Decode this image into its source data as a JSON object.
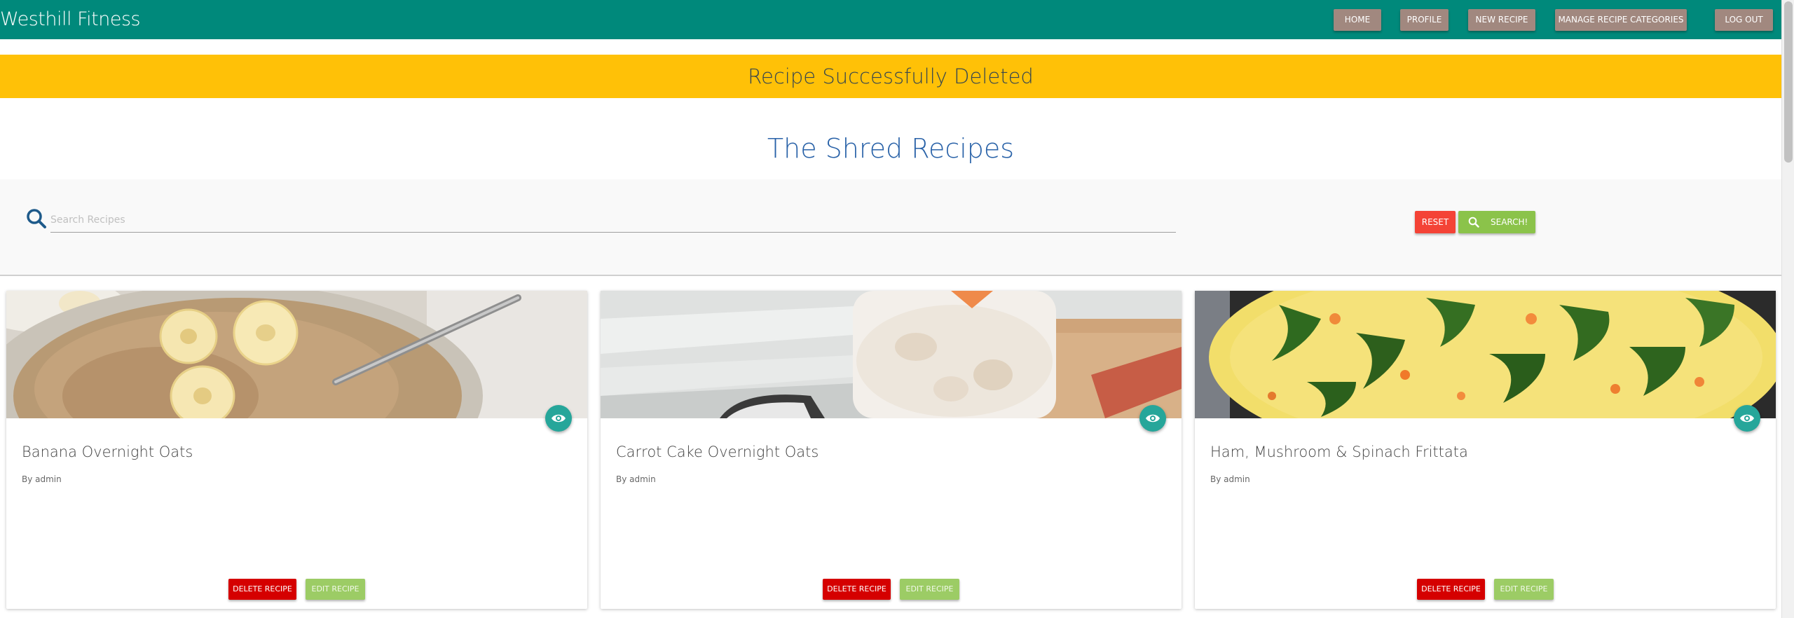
{
  "navbar": {
    "brand": "Westhill Fitness",
    "items": [
      {
        "label": "HOME"
      },
      {
        "label": "PROFILE"
      },
      {
        "label": "NEW RECIPE"
      },
      {
        "label": "MANAGE RECIPE CATEGORIES"
      },
      {
        "label": "LOG OUT"
      }
    ]
  },
  "alert": {
    "message": "Recipe Successfully Deleted",
    "color": "#ffc107"
  },
  "page": {
    "title": "The Shred Recipes"
  },
  "search": {
    "placeholder": "Search Recipes",
    "value": "",
    "reset_label": "RESET",
    "search_label": "SEARCH!"
  },
  "recipes": [
    {
      "title": "Banana Overnight Oats",
      "author": "By admin",
      "delete_label": "DELETE RECIPE",
      "edit_label": "EDIT RECIPE",
      "image": "banana-oats-photo"
    },
    {
      "title": "Carrot Cake Overnight Oats",
      "author": "By admin",
      "delete_label": "DELETE RECIPE",
      "edit_label": "EDIT RECIPE",
      "image": "carrot-cake-oats-photo"
    },
    {
      "title": "Ham, Mushroom & Spinach Frittata",
      "author": "By admin",
      "delete_label": "DELETE RECIPE",
      "edit_label": "EDIT RECIPE",
      "image": "frittata-photo"
    }
  ],
  "colors": {
    "navbar": "#00897b",
    "nav_button": "#a1887f",
    "title": "#2962a8",
    "reset": "#f44336",
    "search": "#8bc34a",
    "delete": "#d50000",
    "edit": "#9ccc65",
    "view_fab": "#26a69a"
  },
  "icons": [
    "search-icon",
    "eye-icon"
  ]
}
